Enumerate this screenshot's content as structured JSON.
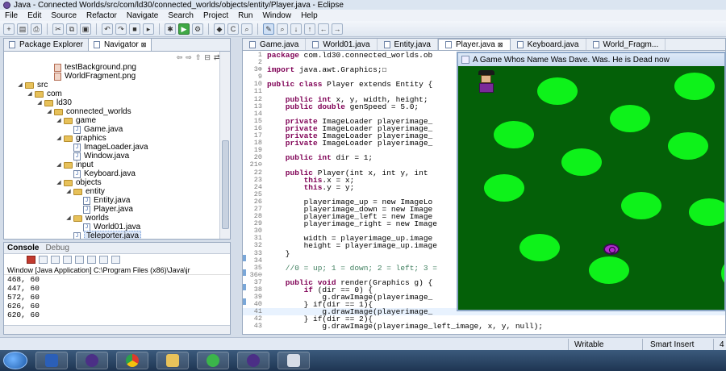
{
  "window": {
    "title": "Java - Connected Worlds/src/com/ld30/connected_worlds/objects/entity/Player.java - Eclipse"
  },
  "menu": [
    "File",
    "Edit",
    "Source",
    "Refactor",
    "Navigate",
    "Search",
    "Project",
    "Run",
    "Window",
    "Help"
  ],
  "left_panel": {
    "tabs": [
      {
        "label": "Package Explorer",
        "active": false
      },
      {
        "label": "Navigator",
        "active": true
      }
    ],
    "tree": [
      {
        "label": "testBackground.png",
        "indent": 5,
        "type": "png",
        "twisty": ""
      },
      {
        "label": "WorldFragment.png",
        "indent": 5,
        "type": "png",
        "twisty": ""
      },
      {
        "label": "src",
        "indent": 2,
        "type": "folder",
        "twisty": "◢"
      },
      {
        "label": "com",
        "indent": 3,
        "type": "folder",
        "twisty": "◢"
      },
      {
        "label": "ld30",
        "indent": 4,
        "type": "folder",
        "twisty": "◢"
      },
      {
        "label": "connected_worlds",
        "indent": 5,
        "type": "folder",
        "twisty": "◢"
      },
      {
        "label": "game",
        "indent": 6,
        "type": "folder",
        "twisty": "◢"
      },
      {
        "label": "Game.java",
        "indent": 7,
        "type": "java",
        "twisty": ""
      },
      {
        "label": "graphics",
        "indent": 6,
        "type": "folder",
        "twisty": "◢"
      },
      {
        "label": "ImageLoader.java",
        "indent": 7,
        "type": "java",
        "twisty": ""
      },
      {
        "label": "Window.java",
        "indent": 7,
        "type": "java",
        "twisty": ""
      },
      {
        "label": "input",
        "indent": 6,
        "type": "folder",
        "twisty": "◢"
      },
      {
        "label": "Keyboard.java",
        "indent": 7,
        "type": "java",
        "twisty": ""
      },
      {
        "label": "objects",
        "indent": 6,
        "type": "folder",
        "twisty": "◢"
      },
      {
        "label": "entity",
        "indent": 7,
        "type": "folder",
        "twisty": "◢"
      },
      {
        "label": "Entity.java",
        "indent": 8,
        "type": "java",
        "twisty": ""
      },
      {
        "label": "Player.java",
        "indent": 8,
        "type": "java",
        "twisty": ""
      },
      {
        "label": "worlds",
        "indent": 7,
        "type": "folder",
        "twisty": "◢"
      },
      {
        "label": "World01.java",
        "indent": 8,
        "type": "java",
        "twisty": ""
      },
      {
        "label": "Teleporter.java",
        "indent": 7,
        "type": "java",
        "twisty": "",
        "selected": true
      }
    ]
  },
  "console": {
    "tabs": [
      {
        "label": "Console",
        "active": true
      },
      {
        "label": "Debug",
        "active": false
      }
    ],
    "terminated": "Window [Java Application] C:\\Program Files (x86)\\Java\\jr",
    "lines": [
      "468, 60",
      "447, 60",
      "572, 60",
      "626, 60",
      "620, 60"
    ]
  },
  "editor": {
    "tabs": [
      {
        "label": "Game.java",
        "active": false
      },
      {
        "label": "World01.java",
        "active": false
      },
      {
        "label": "Entity.java",
        "active": false
      },
      {
        "label": "Player.java",
        "active": true
      },
      {
        "label": "Keyboard.java",
        "active": false
      },
      {
        "label": "World_Fragm...",
        "active": false
      }
    ],
    "lines": [
      {
        "n": "1",
        "t": "package com.ld30.connected_worlds.ob",
        "kind": "kw-start",
        "kw": "package",
        "hl": false
      },
      {
        "n": "2",
        "t": "",
        "kind": "plain",
        "hl": false
      },
      {
        "n": "3⊕",
        "t": "import java.awt.Graphics;☐",
        "kind": "kw-start",
        "kw": "import",
        "hl": false
      },
      {
        "n": "9",
        "t": "",
        "kind": "plain",
        "hl": false
      },
      {
        "n": "10",
        "t": "public class Player extends Entity {",
        "kind": "kw-start",
        "kw": "public class",
        "hl": false
      },
      {
        "n": "11",
        "t": "",
        "kind": "plain",
        "hl": false
      },
      {
        "n": "12",
        "t": "    public int x, y, width, height;",
        "kind": "kw-start",
        "kw": "    public int",
        "hl": false
      },
      {
        "n": "13",
        "t": "    public double genSpeed = 5.0;",
        "kind": "kw-start",
        "kw": "    public double",
        "hl": false
      },
      {
        "n": "14",
        "t": "",
        "kind": "plain",
        "hl": false
      },
      {
        "n": "15",
        "t": "    private ImageLoader playerimage_",
        "kind": "kw-start",
        "kw": "    private",
        "hl": false
      },
      {
        "n": "16",
        "t": "    private ImageLoader playerimage_",
        "kind": "kw-start",
        "kw": "    private",
        "hl": false
      },
      {
        "n": "17",
        "t": "    private ImageLoader playerimage_",
        "kind": "kw-start",
        "kw": "    private",
        "hl": false
      },
      {
        "n": "18",
        "t": "    private ImageLoader playerimage_",
        "kind": "kw-start",
        "kw": "    private",
        "hl": false
      },
      {
        "n": "19",
        "t": "",
        "kind": "plain",
        "hl": false
      },
      {
        "n": "20",
        "t": "    public int dir = 1;",
        "kind": "kw-start",
        "kw": "    public int",
        "hl": false
      },
      {
        "n": "21⊖",
        "t": "",
        "kind": "plain",
        "hl": false
      },
      {
        "n": "22",
        "t": "    public Player(int x, int y, int",
        "kind": "kw-start",
        "kw": "    public",
        "hl": false
      },
      {
        "n": "23",
        "t": "        this.x = x;",
        "kind": "kw-start",
        "kw": "        this",
        "hl": false
      },
      {
        "n": "24",
        "t": "        this.y = y;",
        "kind": "kw-start",
        "kw": "        this",
        "hl": false
      },
      {
        "n": "25",
        "t": "",
        "kind": "plain",
        "hl": false
      },
      {
        "n": "26",
        "t": "        playerimage_up = new ImageLo",
        "kind": "plain",
        "hl": false
      },
      {
        "n": "27",
        "t": "        playerimage_down = new Image",
        "kind": "plain",
        "hl": false
      },
      {
        "n": "28",
        "t": "        playerimage_left = new Image",
        "kind": "plain",
        "hl": false
      },
      {
        "n": "29",
        "t": "        playerimage_right = new Image",
        "kind": "plain",
        "hl": false
      },
      {
        "n": "30",
        "t": "",
        "kind": "plain",
        "hl": false
      },
      {
        "n": "31",
        "t": "        width = playerimage_up.image",
        "kind": "plain",
        "hl": false
      },
      {
        "n": "32",
        "t": "        height = playerimage_up.image",
        "kind": "plain",
        "hl": false
      },
      {
        "n": "33",
        "t": "    }",
        "kind": "plain",
        "hl": false
      },
      {
        "n": "34",
        "t": "",
        "kind": "plain",
        "hl": false
      },
      {
        "n": "35",
        "t": "    //0 = up; 1 = down; 2 = left; 3 =",
        "kind": "comment",
        "hl": false
      },
      {
        "n": "36⊖",
        "t": "",
        "kind": "plain",
        "hl": false
      },
      {
        "n": "37",
        "t": "    public void render(Graphics g) {",
        "kind": "kw-start",
        "kw": "    public void",
        "hl": false
      },
      {
        "n": "38",
        "t": "        if (dir == 0) {",
        "kind": "kw-start",
        "kw": "        if",
        "hl": false
      },
      {
        "n": "39",
        "t": "            g.drawImage(playerimage_",
        "kind": "plain",
        "hl": false
      },
      {
        "n": "40",
        "t": "        } if(dir == 1){",
        "kind": "plain",
        "hl": false
      },
      {
        "n": "41",
        "t": "            g.drawImage(playerimage_",
        "kind": "plain",
        "hl": true
      },
      {
        "n": "42",
        "t": "        } if(dir == 2){",
        "kind": "plain",
        "hl": false
      },
      {
        "n": "43",
        "t": "            g.drawImage(playerimage_left_image, x, y, null);",
        "kind": "plain",
        "hl": false
      }
    ]
  },
  "game_window": {
    "title": "A Game Whos Name Was Dave. Was. He is Dead now"
  },
  "status": {
    "writable": "Writable",
    "insert": "Smart Insert",
    "position": "4"
  }
}
